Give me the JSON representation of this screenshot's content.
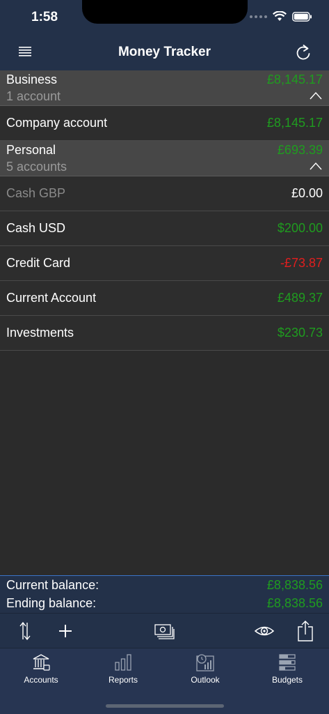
{
  "status_bar": {
    "time": "1:58"
  },
  "nav": {
    "title": "Money Tracker",
    "menu_icon": "hamburger-icon",
    "refresh_icon": "refresh-icon"
  },
  "groups": [
    {
      "name": "Business",
      "count": "1 account",
      "total": "£8,145.17",
      "accounts": [
        {
          "name": "Company account",
          "value": "£8,145.17",
          "color": "green"
        }
      ]
    },
    {
      "name": "Personal",
      "count": "5 accounts",
      "total": "£693.39",
      "accounts": [
        {
          "name": "Cash GBP",
          "value": "£0.00",
          "color": "white"
        },
        {
          "name": "Cash USD",
          "value": "$200.00",
          "color": "green"
        },
        {
          "name": "Credit Card",
          "value": "-£73.87",
          "color": "red"
        },
        {
          "name": "Current Account",
          "value": "£489.37",
          "color": "green"
        },
        {
          "name": "Investments",
          "value": "$230.73",
          "color": "green"
        }
      ]
    }
  ],
  "totals": {
    "current_label": "Current balance:",
    "current_value": "£8,838.56",
    "ending_label": "Ending balance:",
    "ending_value": "£8,838.56"
  },
  "toolbar": {
    "items": [
      "sort-arrows-icon",
      "plus-icon",
      "banknotes-icon",
      "eye-icon",
      "share-icon"
    ]
  },
  "tabs": [
    {
      "label": "Accounts",
      "icon": "bank-icon"
    },
    {
      "label": "Reports",
      "icon": "bar-chart-icon"
    },
    {
      "label": "Outlook",
      "icon": "calendar-chart-icon"
    },
    {
      "label": "Budgets",
      "icon": "budget-stack-icon"
    }
  ],
  "colors": {
    "green": "#1f9c1f",
    "red": "#e01e1e",
    "nav_bg": "#233149",
    "accent": "#3a74c8"
  }
}
